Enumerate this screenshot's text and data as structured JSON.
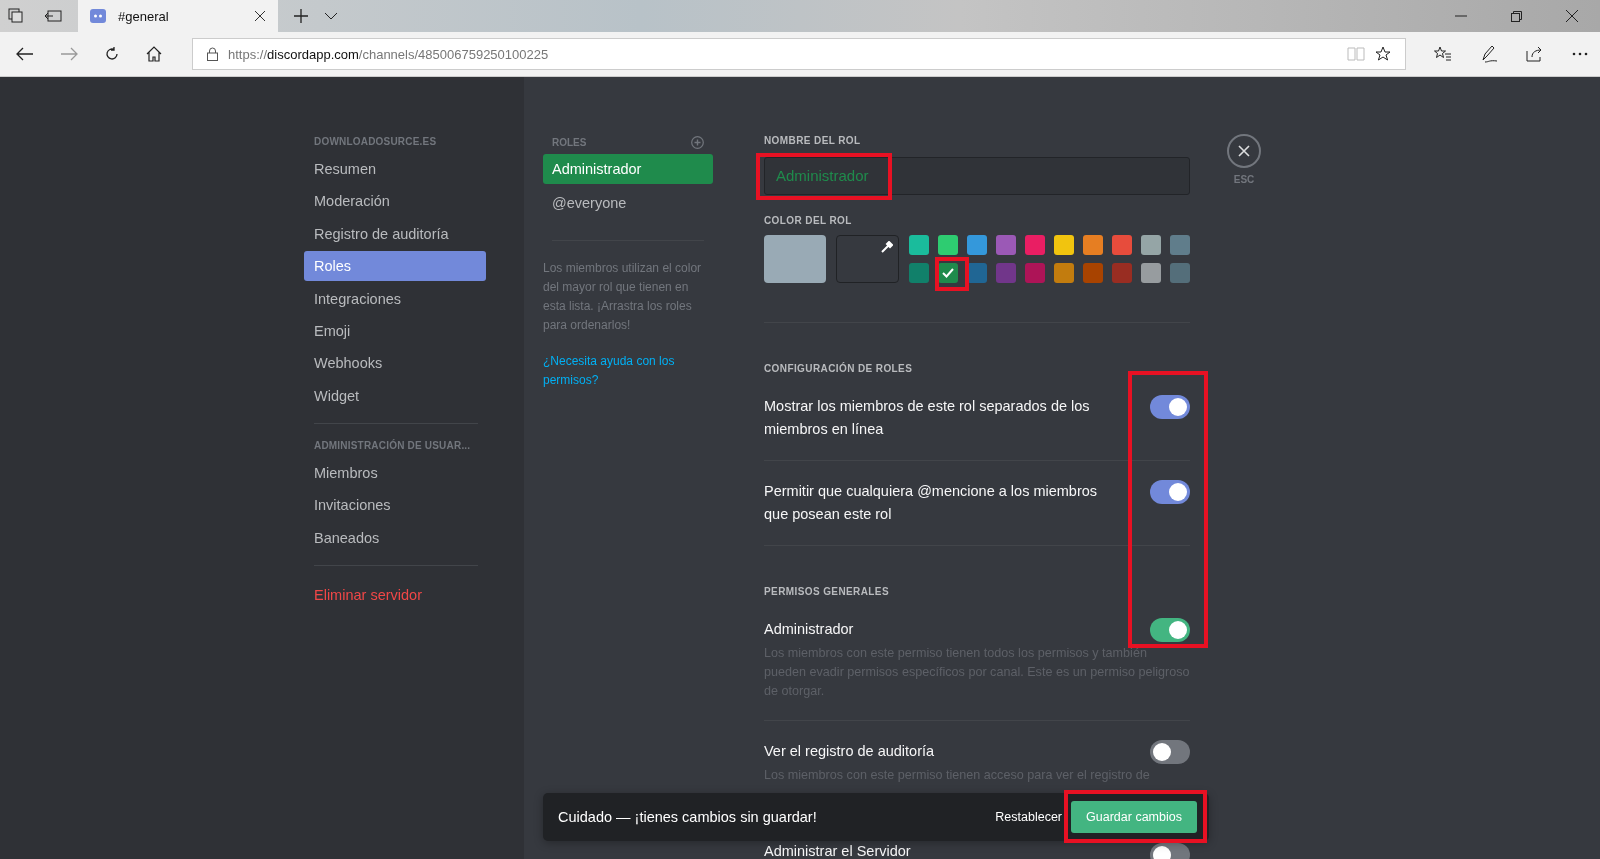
{
  "browser": {
    "tabs": [
      {
        "title": "#general",
        "selected": true
      }
    ],
    "url": {
      "scheme": "https://",
      "host": "discordapp.com",
      "path": "/channels/485006759250100225"
    }
  },
  "sidebar": {
    "groups": [
      {
        "header": "DOWNLOADOSURCE.ES",
        "items": [
          {
            "label": "Resumen",
            "selected": false
          },
          {
            "label": "Moderación",
            "selected": false
          },
          {
            "label": "Registro de auditoría",
            "selected": false
          },
          {
            "label": "Roles",
            "selected": true
          },
          {
            "label": "Integraciones",
            "selected": false
          },
          {
            "label": "Emoji",
            "selected": false
          },
          {
            "label": "Webhooks",
            "selected": false
          },
          {
            "label": "Widget",
            "selected": false
          }
        ]
      },
      {
        "header": "ADMINISTRACIÓN DE USUAR...",
        "items": [
          {
            "label": "Miembros",
            "selected": false
          },
          {
            "label": "Invitaciones",
            "selected": false
          },
          {
            "label": "Baneados",
            "selected": false
          }
        ]
      }
    ],
    "danger_item": "Eliminar servidor"
  },
  "roles_panel": {
    "header": "ROLES",
    "roles": [
      {
        "name": "Administrador",
        "selected": true
      },
      {
        "name": "@everyone",
        "selected": false
      }
    ],
    "hint": "Los miembros utilizan el color del mayor rol que tienen en esta lista. ¡Arrastra los roles para ordenarlos!",
    "help_link": "¿Necesita ayuda con los permisos?"
  },
  "editor": {
    "name_label": "NOMBRE DEL ROL",
    "name_value": "Administrador",
    "color_label": "COLOR DEL ROL",
    "swatches": [
      {
        "color": "#1abc9c",
        "selected": false
      },
      {
        "color": "#2ecc71",
        "selected": false
      },
      {
        "color": "#3498db",
        "selected": false
      },
      {
        "color": "#9b59b6",
        "selected": false
      },
      {
        "color": "#e91e63",
        "selected": false
      },
      {
        "color": "#f1c40f",
        "selected": false
      },
      {
        "color": "#e67e22",
        "selected": false
      },
      {
        "color": "#e74c3c",
        "selected": false
      },
      {
        "color": "#95a5a6",
        "selected": false
      },
      {
        "color": "#607d8b",
        "selected": false
      },
      {
        "color": "#11806a",
        "selected": false
      },
      {
        "color": "#1f8b4c",
        "selected": true
      },
      {
        "color": "#206694",
        "selected": false
      },
      {
        "color": "#71368a",
        "selected": false
      },
      {
        "color": "#ad1457",
        "selected": false
      },
      {
        "color": "#c27c0e",
        "selected": false
      },
      {
        "color": "#a84300",
        "selected": false
      },
      {
        "color": "#992d22",
        "selected": false
      },
      {
        "color": "#979c9f",
        "selected": false
      },
      {
        "color": "#546e7a",
        "selected": false
      }
    ],
    "sections": [
      {
        "kind": "config",
        "title": "CONFIGURACIÓN DE ROLES",
        "options": [
          {
            "label": "Mostrar los miembros de este rol separados de los miembros en línea",
            "on": true
          },
          {
            "label": "Permitir que cualquiera @mencione a los miembros que posean este rol",
            "on": true
          }
        ]
      },
      {
        "kind": "permissions",
        "title": "PERMISOS GENERALES",
        "options": [
          {
            "label": "Administrador",
            "description": "Los miembros con este permiso tienen todos los permisos y también pueden evadir permisos específicos por canal. Este es un permiso peligroso de otorgar.",
            "on": true
          },
          {
            "label": "Ver el registro de auditoría",
            "description": "Los miembros con este permiso tienen acceso para ver el registro de",
            "on": false
          },
          {
            "label": "Administrar el Servidor",
            "on": false
          }
        ]
      }
    ]
  },
  "close": {
    "label": "ESC"
  },
  "notice": {
    "message": "Cuidado — ¡tienes cambios sin guardar!",
    "reset": "Restablecer",
    "save": "Guardar cambios"
  }
}
